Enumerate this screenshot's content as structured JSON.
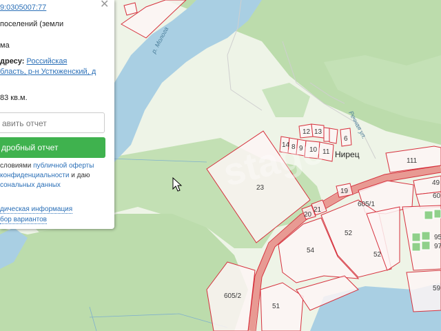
{
  "panel": {
    "cadastral_number": "9:0305007:77",
    "category": "поселений (земли",
    "type_suffix": "ма",
    "address_label": "дресу:",
    "address_line1": "Российская",
    "address_line2": "бласть, р-н Устюженский, д",
    "area": "83 кв.м.",
    "view_report_button": "авить отчет",
    "detail_report_button": "дробный отчет",
    "terms_prefix": "словиями",
    "terms_link": "публичной оферты",
    "privacy_link": "конфиденциальности",
    "privacy_suffix": "и даю",
    "personal_data_link": "сональных данных",
    "legal_info_link": "дическая информация",
    "options_link": "бор вариантов",
    "close_icon": "close-icon"
  },
  "map": {
    "river_name": "р. Молога",
    "street_name": "Речная ул.",
    "village_name": "Нирец",
    "watermark": "stage",
    "plots": [
      "23",
      "12",
      "13",
      "14",
      "8",
      "9",
      "10",
      "11",
      "6",
      "111",
      "19",
      "20",
      "21",
      "605/1",
      "52",
      "52",
      "54",
      "49",
      "60",
      "95",
      "97",
      "605/2",
      "51",
      "59"
    ],
    "colors": {
      "water": "#a9cfe3",
      "forest": "#b9dcaa",
      "meadow": "#ecf3e4",
      "plot_border": "#d6303c",
      "plot_fill": "#fdf3f3",
      "road": "#e89a93",
      "accent_green": "#3fb24e"
    }
  }
}
